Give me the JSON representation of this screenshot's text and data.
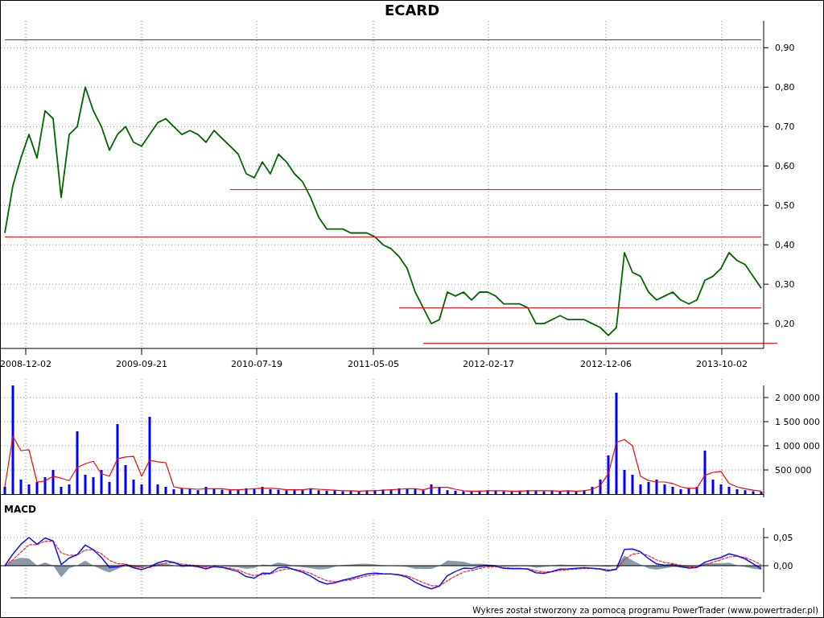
{
  "title": "ECARD",
  "price_chart": {
    "chart_data": {
      "type": "line",
      "grid": true,
      "series": [
        {
          "color": "#006400",
          "values": [
            0.43,
            0.55,
            0.62,
            0.68,
            0.62,
            0.74,
            0.72,
            0.52,
            0.68,
            0.7,
            0.8,
            0.74,
            0.7,
            0.64,
            0.68,
            0.7,
            0.66,
            0.65,
            0.68,
            0.71,
            0.72,
            0.7,
            0.68,
            0.69,
            0.68,
            0.66,
            0.69,
            0.67,
            0.65,
            0.63,
            0.58,
            0.57,
            0.61,
            0.58,
            0.63,
            0.61,
            0.58,
            0.56,
            0.52,
            0.47,
            0.44,
            0.44,
            0.44,
            0.43,
            0.43,
            0.43,
            0.42,
            0.4,
            0.39,
            0.37,
            0.34,
            0.28,
            0.24,
            0.2,
            0.21,
            0.28,
            0.27,
            0.28,
            0.26,
            0.28,
            0.28,
            0.27,
            0.25,
            0.25,
            0.25,
            0.24,
            0.2,
            0.2,
            0.21,
            0.22,
            0.21,
            0.21,
            0.21,
            0.2,
            0.19,
            0.17,
            0.19,
            0.38,
            0.33,
            0.32,
            0.28,
            0.26,
            0.27,
            0.28,
            0.26,
            0.25,
            0.26,
            0.31,
            0.32,
            0.34,
            0.38,
            0.36,
            0.35,
            0.32,
            0.29
          ]
        },
        {
          "color": "#ff0000",
          "values": [
            0.92,
            0.92,
            0.92,
            0.92,
            0.92,
            0.92,
            0.92,
            0.92,
            0.92,
            0.92,
            0.92,
            0.92,
            0.92,
            0.92,
            0.92,
            0.92,
            0.92,
            0.92,
            0.92,
            0.92,
            0.92,
            0.92,
            0.92,
            0.92,
            0.92,
            0.92,
            0.92,
            0.92,
            0.92,
            0.92,
            0.92,
            0.92,
            0.92,
            0.92,
            0.92,
            0.92,
            0.92,
            0.92,
            0.92,
            0.92,
            0.92,
            0.92,
            0.92,
            0.92,
            0.92,
            0.92,
            0.92,
            0.92,
            0.92,
            0.92,
            0.92,
            0.92,
            0.92,
            0.92,
            0.92,
            0.92,
            0.92,
            0.92,
            0.92,
            0.92,
            0.92,
            0.92,
            0.92,
            0.92,
            0.92,
            0.92,
            0.92,
            0.92,
            0.92,
            0.92,
            0.92,
            0.92,
            0.92,
            0.92,
            0.92,
            0.92,
            0.92,
            0.92,
            0.92,
            0.92,
            0.92,
            0.92,
            0.92,
            0.92,
            0.92,
            0.92,
            0.92,
            0.92,
            0.92,
            0.92,
            0.92,
            0.92,
            0.92,
            0.92,
            0.92
          ]
        },
        {
          "color": "#ff0000",
          "values": [
            null,
            null,
            null,
            null,
            null,
            null,
            null,
            null,
            null,
            null,
            null,
            null,
            null,
            null,
            null,
            null,
            null,
            null,
            null,
            null,
            null,
            null,
            null,
            null,
            null,
            null,
            null,
            null,
            0.54,
            0.54,
            0.54,
            0.54,
            0.54,
            0.54,
            0.54,
            0.54,
            0.54,
            0.54,
            0.54,
            0.54,
            0.54,
            0.54,
            0.54,
            0.54,
            0.54,
            0.54,
            0.54,
            0.54,
            0.54,
            0.54,
            0.54,
            0.54,
            0.54,
            0.54,
            0.54,
            0.54,
            0.54,
            0.54,
            0.54,
            0.54,
            0.54,
            0.54,
            0.54,
            0.54,
            0.54,
            0.54,
            0.54,
            0.54,
            0.54,
            0.54,
            0.54,
            0.54,
            0.54,
            0.54,
            0.54,
            0.54,
            0.54,
            0.54,
            0.54,
            0.54,
            0.54,
            0.54,
            0.54,
            0.54,
            0.54,
            0.54,
            0.54,
            0.54,
            0.54,
            0.54,
            0.54,
            0.54,
            0.54,
            0.54,
            0.54
          ]
        },
        {
          "color": "#ff0000",
          "values": [
            0.42,
            0.42,
            0.42,
            0.42,
            0.42,
            0.42,
            0.42,
            0.42,
            0.42,
            0.42,
            0.42,
            0.42,
            0.42,
            0.42,
            0.42,
            0.42,
            0.42,
            0.42,
            0.42,
            0.42,
            0.42,
            0.42,
            0.42,
            0.42,
            0.42,
            0.42,
            0.42,
            0.42,
            0.42,
            0.42,
            0.42,
            0.42,
            0.42,
            0.42,
            0.42,
            0.42,
            0.42,
            0.42,
            0.42,
            0.42,
            0.42,
            0.42,
            0.42,
            0.42,
            0.42,
            0.42,
            0.42,
            0.42,
            0.42,
            0.42,
            0.42,
            0.42,
            0.42,
            0.42,
            0.42,
            0.42,
            0.42,
            0.42,
            0.42,
            0.42,
            0.42,
            0.42,
            0.42,
            0.42,
            0.42,
            0.42,
            0.42,
            0.42,
            0.42,
            0.42,
            0.42,
            0.42,
            0.42,
            0.42,
            0.42,
            0.42,
            0.42,
            0.42,
            0.42,
            0.42,
            0.42,
            0.42,
            0.42,
            0.42,
            0.42,
            0.42,
            0.42,
            0.42,
            0.42,
            0.42,
            0.42,
            0.42,
            0.42,
            0.42,
            0.42
          ]
        },
        {
          "color": "#ff0000",
          "values": [
            null,
            null,
            null,
            null,
            null,
            null,
            null,
            null,
            null,
            null,
            null,
            null,
            null,
            null,
            null,
            null,
            null,
            null,
            null,
            null,
            null,
            null,
            null,
            null,
            null,
            null,
            null,
            null,
            null,
            null,
            null,
            null,
            null,
            null,
            null,
            null,
            null,
            null,
            null,
            null,
            null,
            null,
            null,
            null,
            null,
            null,
            null,
            null,
            null,
            0.24,
            0.24,
            0.24,
            0.24,
            0.24,
            0.24,
            0.24,
            0.24,
            0.24,
            0.24,
            0.24,
            0.24,
            0.24,
            0.24,
            0.24,
            0.24,
            0.24,
            0.24,
            0.24,
            0.24,
            0.24,
            0.24,
            0.24,
            0.24,
            0.24,
            0.24,
            0.24,
            0.24,
            0.24,
            0.24,
            0.24,
            0.24,
            0.24,
            0.24,
            0.24,
            0.24,
            0.24,
            0.24,
            0.24,
            0.24,
            0.24,
            0.24,
            0.24,
            0.24,
            0.24,
            0.24
          ]
        },
        {
          "color": "#ff0000",
          "values": [
            null,
            null,
            null,
            null,
            null,
            null,
            null,
            null,
            null,
            null,
            null,
            null,
            null,
            null,
            null,
            null,
            null,
            null,
            null,
            null,
            null,
            null,
            null,
            null,
            null,
            null,
            null,
            null,
            null,
            null,
            null,
            null,
            null,
            null,
            null,
            null,
            null,
            null,
            null,
            null,
            null,
            null,
            null,
            null,
            null,
            null,
            null,
            null,
            null,
            null,
            null,
            null,
            0.15,
            0.15,
            0.15,
            0.15,
            0.15,
            0.15,
            0.15,
            0.15,
            0.15,
            0.15,
            0.15,
            0.15,
            0.15,
            0.15,
            0.15,
            0.15,
            0.15,
            0.15,
            0.15,
            0.15,
            0.15,
            0.15,
            0.15,
            0.15,
            0.15,
            0.15,
            0.15,
            0.15,
            0.15,
            0.15,
            0.15,
            0.15,
            0.15,
            0.15,
            0.15,
            0.15,
            0.15,
            0.15,
            0.15,
            0.15,
            0.15,
            0.15,
            0.15,
            0.15,
            0.15
          ]
        }
      ],
      "ylim": [
        0.137,
        0.968
      ],
      "yticks": [
        {
          "value": 0.2,
          "label": "0,20"
        },
        {
          "value": 0.3,
          "label": "0,30"
        },
        {
          "value": 0.4,
          "label": "0,40"
        },
        {
          "value": 0.5,
          "label": "0,50"
        },
        {
          "value": 0.6,
          "label": "0,60"
        },
        {
          "value": 0.7,
          "label": "0,70"
        },
        {
          "value": 0.8,
          "label": "0,80"
        },
        {
          "value": 0.9,
          "label": "0,90"
        }
      ]
    },
    "date_labels": [
      "2008-12-02",
      "2009-09-21",
      "2010-07-19",
      "2011-05-05",
      "2012-02-17",
      "2012-12-06",
      "2013-10-02"
    ]
  },
  "volume_chart": {
    "chart_data": {
      "type": "bar",
      "grid": true,
      "series": [
        {
          "color": "#0000ff",
          "values": [
            150000,
            2250000,
            300000,
            200000,
            250000,
            350000,
            500000,
            150000,
            200000,
            1300000,
            400000,
            350000,
            500000,
            250000,
            1450000,
            600000,
            300000,
            200000,
            1600000,
            200000,
            150000,
            100000,
            120000,
            100000,
            80000,
            150000,
            100000,
            90000,
            80000,
            100000,
            120000,
            100000,
            150000,
            100000,
            90000,
            80000,
            100000,
            100000,
            120000,
            80000,
            70000,
            80000,
            60000,
            70000,
            60000,
            70000,
            80000,
            90000,
            100000,
            120000,
            100000,
            100000,
            80000,
            200000,
            150000,
            80000,
            70000,
            60000,
            60000,
            70000,
            80000,
            70000,
            60000,
            60000,
            70000,
            80000,
            70000,
            60000,
            70000,
            60000,
            70000,
            60000,
            80000,
            150000,
            300000,
            800000,
            2100000,
            500000,
            400000,
            200000,
            250000,
            300000,
            200000,
            150000,
            100000,
            120000,
            150000,
            900000,
            300000,
            200000,
            150000,
            100000,
            80000,
            60000,
            50000
          ]
        },
        {
          "type": "line",
          "color": "#ff0000",
          "values": [
            150000,
            1200000,
            900000,
            920000,
            250000,
            270000,
            370000,
            330000,
            280000,
            550000,
            630000,
            680000,
            420000,
            370000,
            730000,
            770000,
            780000,
            370000,
            700000,
            670000,
            650000,
            150000,
            120000,
            110000,
            100000,
            110000,
            110000,
            110000,
            90000,
            90000,
            100000,
            110000,
            120000,
            120000,
            110000,
            90000,
            90000,
            90000,
            110000,
            100000,
            90000,
            80000,
            70000,
            70000,
            60000,
            70000,
            70000,
            80000,
            90000,
            100000,
            110000,
            110000,
            90000,
            130000,
            140000,
            140000,
            100000,
            70000,
            60000,
            60000,
            70000,
            70000,
            70000,
            60000,
            60000,
            70000,
            70000,
            70000,
            70000,
            60000,
            70000,
            60000,
            70000,
            100000,
            180000,
            420000,
            1070000,
            1130000,
            1000000,
            370000,
            280000,
            250000,
            250000,
            220000,
            150000,
            120000,
            120000,
            390000,
            450000,
            470000,
            220000,
            150000,
            110000,
            80000,
            60000
          ]
        }
      ],
      "ylim": [
        0,
        2250000
      ],
      "yticks": [
        {
          "value": 500000,
          "label": "500 000"
        },
        {
          "value": 1000000,
          "label": "1 000 000"
        },
        {
          "value": 1500000,
          "label": "1 500 000"
        },
        {
          "value": 2000000,
          "label": "2 000 000"
        }
      ]
    }
  },
  "macd": {
    "title": "MACD",
    "ticks": [
      "0,05",
      "0,00"
    ]
  },
  "footer": "Wykres został stworzony za pomocą programu PowerTrader (www.powertrader.pl)"
}
